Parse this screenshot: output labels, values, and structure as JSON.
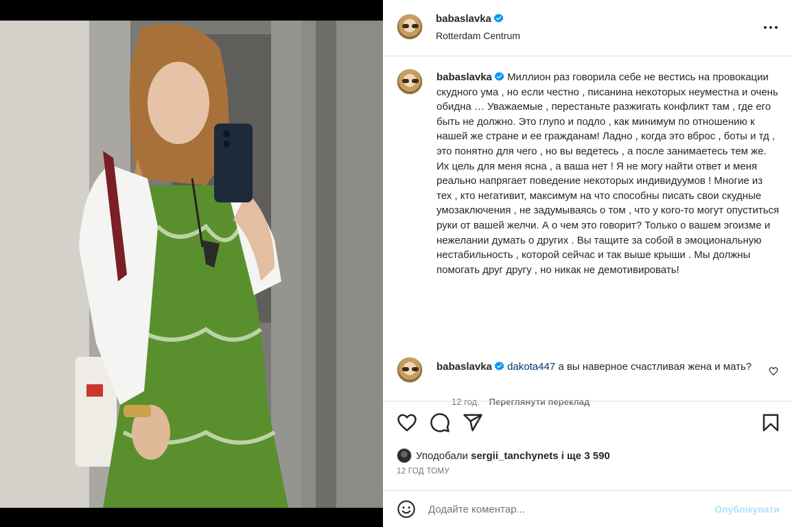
{
  "post": {
    "username": "babaslavka",
    "location": "Rotterdam Centrum",
    "photo_alt": "Mirror selfie in elevator"
  },
  "caption": {
    "username": "babaslavka",
    "text": "Миллион раз говорила себе не вестись на провокации скудного ума , но если честно , писанина некоторых неуместна и очень обидна … Уважаемые , перестаньте разжигать конфликт там , где его быть не должно. Это глупо и подло , как минимум по отношению к нашей же стране и ее гражданам! Ладно , когда это вброс , боты и тд , это понятно для чего , но вы ведетесь , а после занимаетесь тем же. Их цель для меня ясна , а ваша нет ! Я не могу найти ответ и меня реально напрягает поведение некоторых индивидуумов ! Многие из тех , кто негативит, максимум на что способны писать свои скудные умозаключения , не задумываясь о том , что у кого-то могут опуститься руки от вашей желчи. А о чем это говорит? Только о вашем эгоизме и нежелании думать о других . Вы тащите за собой в эмоциональную нестабильность , которой сейчас и так выше крыши . Мы должны помогать друг другу , но никак не демотивировать!",
    "age": "12 год.",
    "translate_label": "Переглянути переклад"
  },
  "comment": {
    "username": "babaslavka",
    "mention": "dakota447",
    "text": "а вы наверное счастливая жена и мать?"
  },
  "actions": {
    "likes_prefix": "Уподобали",
    "liker": "sergii_tanchynets",
    "likes_suffix": "і ще 3 590",
    "time": "12 год тому"
  },
  "add_comment": {
    "placeholder": "Додайте коментар...",
    "publish_label": "Опублікувати"
  },
  "colors": {
    "verified": "#0095f6",
    "publish_disabled": "#b2dffc",
    "border": "#dbdbdb"
  },
  "icons": [
    "verified-badge-icon",
    "more-options-icon",
    "heart-icon",
    "comment-icon",
    "share-icon",
    "save-icon",
    "emoji-icon"
  ]
}
